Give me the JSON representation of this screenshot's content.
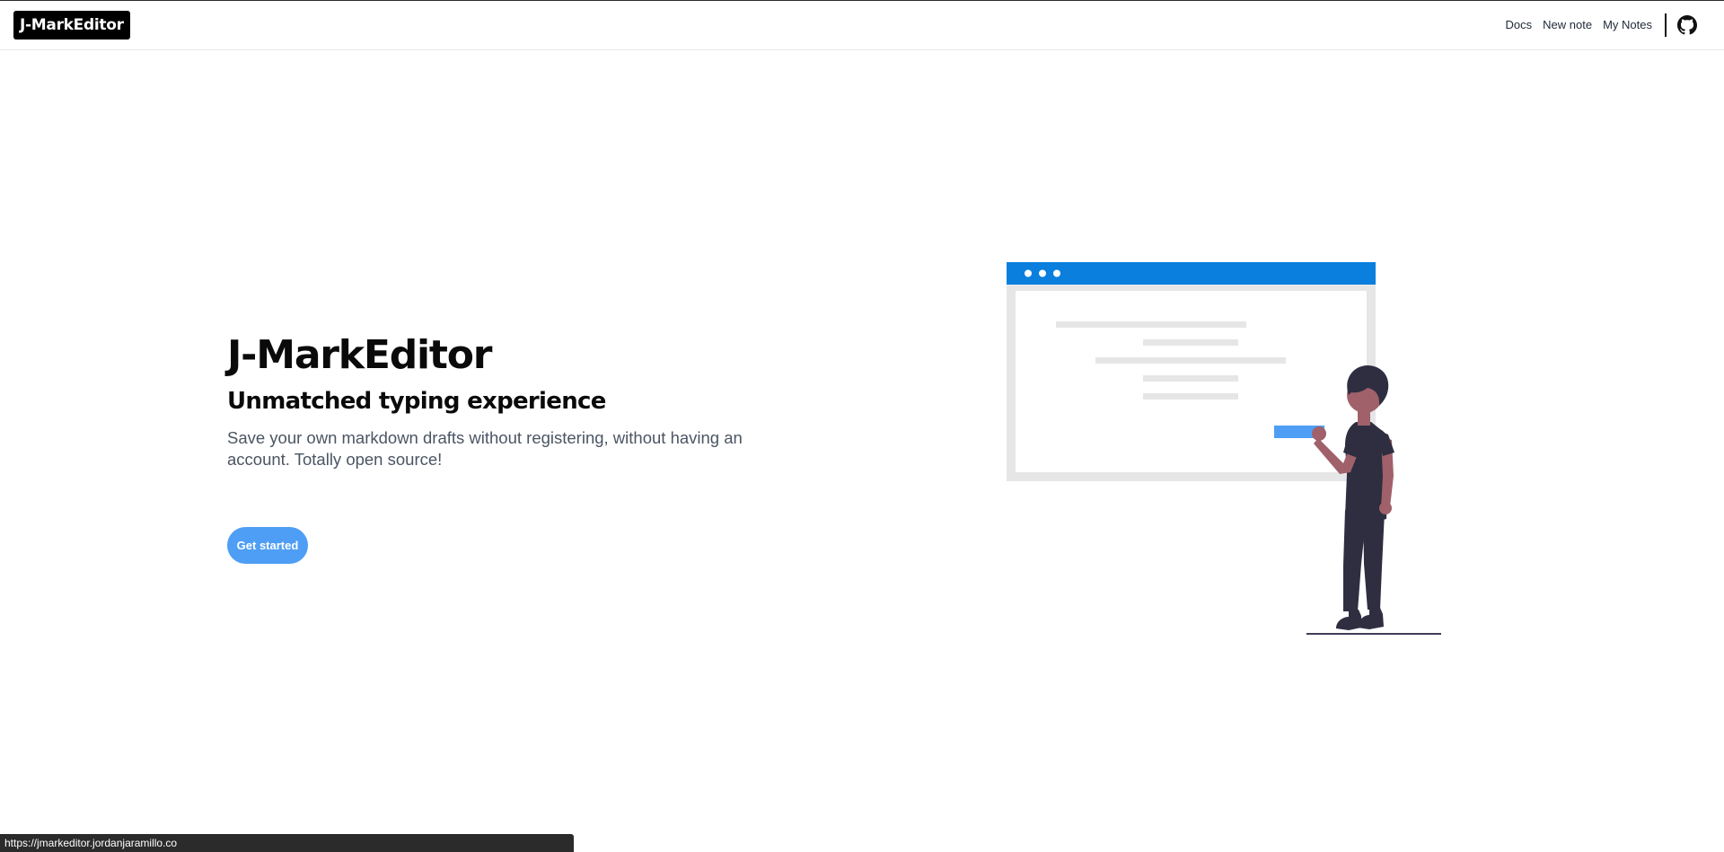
{
  "navbar": {
    "brand": "J-MarkEditor",
    "links": [
      "Docs",
      "New note",
      "My Notes"
    ],
    "github_icon": "github-icon"
  },
  "hero": {
    "title": "J-MarkEditor",
    "subtitle": "Unmatched typing experience",
    "description": "Save your own markdown drafts without registering, without having an account. Totally open source!",
    "cta_label": "Get started"
  },
  "illustration": {
    "name": "person-presenting-window-illustration",
    "colors": {
      "window_bar": "#0a7fdd",
      "window_frame": "#e6e6e6",
      "highlight": "#4f9ef5",
      "clothing": "#2f2e41",
      "skin": "#a0616a"
    }
  },
  "status_bar": {
    "url": "https://jmarkeditor.jordanjaramillo.co"
  }
}
